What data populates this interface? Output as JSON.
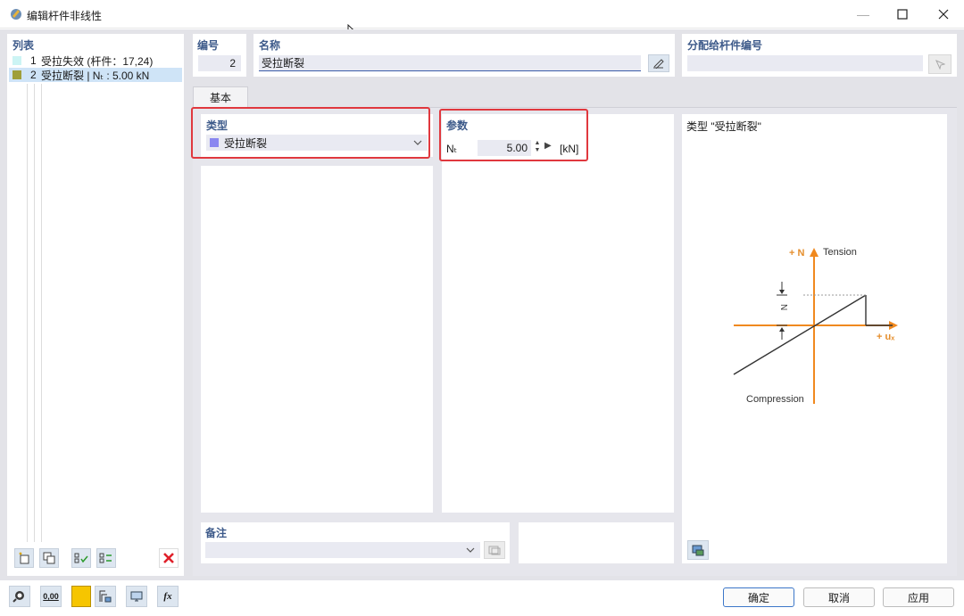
{
  "window": {
    "title": "编辑杆件非线性",
    "min_icon": "minimize-icon",
    "max_icon": "maximize-icon",
    "close_icon": "close-icon"
  },
  "list": {
    "label": "列表",
    "items": [
      {
        "num": "1",
        "text": "受拉失效 (杆件：17,24)",
        "color": "#ccf4f4"
      },
      {
        "num": "2",
        "text": "受拉断裂 | Nₜ : 5.00 kN",
        "color": "#9f9f3a",
        "selected": true
      }
    ]
  },
  "number": {
    "label": "编号",
    "value": "2"
  },
  "name": {
    "label": "名称",
    "value": "受拉断裂"
  },
  "assign": {
    "label": "分配给杆件编号",
    "value": ""
  },
  "tabs": [
    {
      "label": "基本"
    }
  ],
  "type_section": {
    "label": "类型",
    "selected": "受拉断裂",
    "swatch_color": "#8a87f0"
  },
  "params": {
    "label": "参数",
    "nt_label": "Nₜ",
    "nt_value": "5.00",
    "unit": "[kN]"
  },
  "diagram": {
    "title": "类型 \"受拉断裂\"",
    "axis_n": "+ N",
    "tension": "Tension",
    "compression": "Compression",
    "axis_u": "+ uₓ",
    "n_marker": "N"
  },
  "comment": {
    "label": "备注",
    "value": ""
  },
  "buttons": {
    "ok": "确定",
    "cancel": "取消",
    "apply": "应用"
  },
  "bottom_toolbar": {
    "zero_label": "0,00"
  },
  "colors": {
    "accent": "#3d5a8a",
    "highlight": "#e0383e",
    "orange": "#f0891f"
  }
}
